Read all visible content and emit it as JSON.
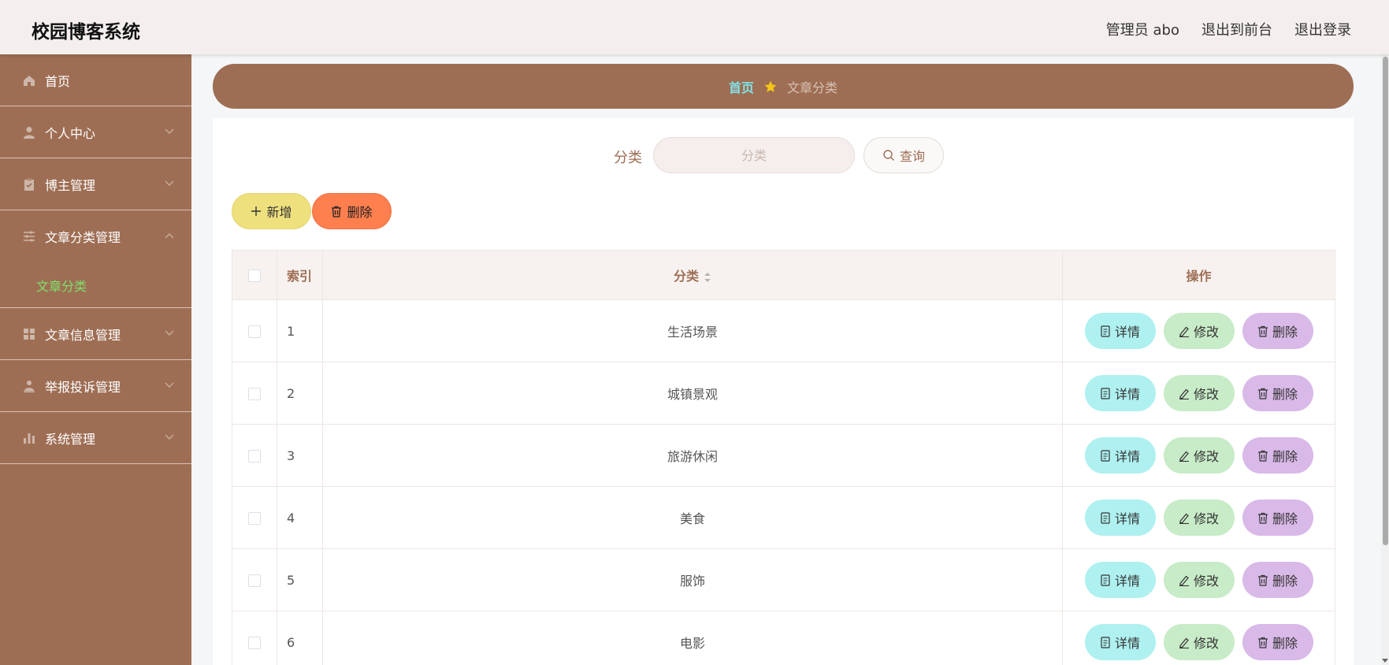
{
  "app": {
    "title": "校园博客系统"
  },
  "header": {
    "user": "管理员 abo",
    "to_front": "退出到前台",
    "logout": "退出登录"
  },
  "sidebar": {
    "items": [
      {
        "label": "首页",
        "icon": "home-icon"
      },
      {
        "label": "个人中心",
        "icon": "user-icon"
      },
      {
        "label": "博主管理",
        "icon": "clipboard-icon"
      },
      {
        "label": "文章分类管理",
        "icon": "sliders-icon",
        "sub": "文章分类"
      },
      {
        "label": "文章信息管理",
        "icon": "grid-icon"
      },
      {
        "label": "举报投诉管理",
        "icon": "person-icon"
      },
      {
        "label": "系统管理",
        "icon": "bar-chart-icon"
      }
    ]
  },
  "breadcrumb": {
    "home": "首页",
    "current": "文章分类"
  },
  "search": {
    "label": "分类",
    "placeholder": "分类",
    "button": "查询"
  },
  "toolbar": {
    "add": "新增",
    "delete": "删除"
  },
  "table": {
    "headers": {
      "index": "索引",
      "category": "分类",
      "ops": "操作"
    },
    "rows": [
      {
        "index": "1",
        "category": "生活场景"
      },
      {
        "index": "2",
        "category": "城镇景观"
      },
      {
        "index": "3",
        "category": "旅游休闲"
      },
      {
        "index": "4",
        "category": "美食"
      },
      {
        "index": "5",
        "category": "服饰"
      },
      {
        "index": "6",
        "category": "电影"
      }
    ],
    "ops": {
      "detail": "详情",
      "edit": "修改",
      "delete": "删除"
    }
  },
  "colors": {
    "brand": "#9e6e54",
    "active": "#7fe06a",
    "crumb_home": "#7fe3e8"
  }
}
